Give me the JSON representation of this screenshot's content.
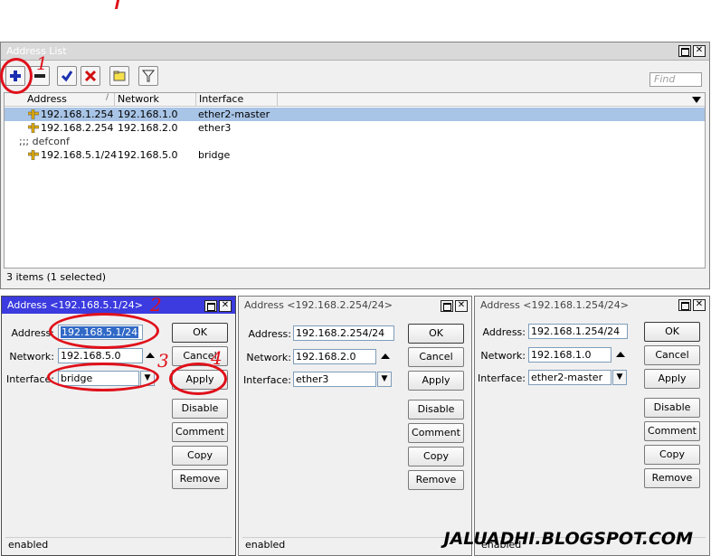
{
  "main_window": {
    "title": "Address List",
    "find_placeholder": "Find",
    "columns": [
      "Address",
      "Network",
      "Interface"
    ],
    "rows": [
      {
        "address": "192.168.1.254",
        "network": "192.168.1.0",
        "interface": "ether2-master",
        "selected": true
      },
      {
        "address": "192.168.2.254",
        "network": "192.168.2.0",
        "interface": "ether3",
        "selected": false
      },
      {
        "comment": ";;; defconf"
      },
      {
        "address": "192.168.5.1/24",
        "network": "192.168.5.0",
        "interface": "bridge",
        "selected": false
      }
    ],
    "status": "3 items (1 selected)",
    "tools": [
      "add-icon",
      "remove-icon",
      "enable-icon",
      "disable-icon",
      "comment-icon",
      "filter-icon"
    ]
  },
  "windows": [
    {
      "title": "Address <192.168.5.1/24>",
      "address_label": "Address:",
      "address_value": "192.168.5.1/24",
      "network_label": "Network:",
      "network_value": "192.168.5.0",
      "interface_label": "Interface:",
      "interface_value": "bridge",
      "status": "enabled"
    },
    {
      "title": "Address <192.168.2.254/24>",
      "address_label": "Address:",
      "address_value": "192.168.2.254/24",
      "network_label": "Network:",
      "network_value": "192.168.2.0",
      "interface_label": "Interface:",
      "interface_value": "ether3",
      "status": "enabled"
    },
    {
      "title": "Address <192.168.1.254/24>",
      "address_label": "Address:",
      "address_value": "192.168.1.254/24",
      "network_label": "Network:",
      "network_value": "192.168.1.0",
      "interface_label": "Interface:",
      "interface_value": "ether2-master",
      "status": "enabled"
    }
  ],
  "buttons": {
    "ok": "OK",
    "cancel": "Cancel",
    "apply": "Apply",
    "disable": "Disable",
    "comment": "Comment",
    "copy": "Copy",
    "remove": "Remove"
  },
  "annotations": [
    "1",
    "2",
    "3",
    "4"
  ],
  "watermark": "JALUADHI.BLOGSPOT.COM",
  "colors": {
    "selection": "#a8c4e6",
    "active_title": "#3b3be0",
    "annotation": "#e0101a"
  }
}
